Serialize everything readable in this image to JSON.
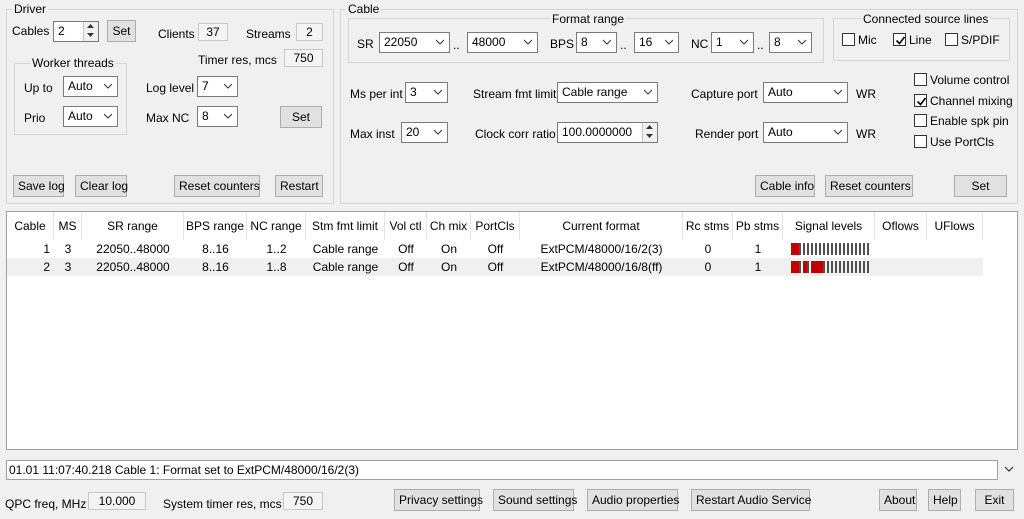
{
  "driver": {
    "title": "Driver",
    "cables_label": "Cables",
    "cables_value": "2",
    "set_label": "Set",
    "clients_label": "Clients",
    "clients_value": "37",
    "streams_label": "Streams",
    "streams_value": "2",
    "timer_label": "Timer res, mcs",
    "timer_value": "750",
    "worker_threads": {
      "title": "Worker threads",
      "upto_label": "Up to",
      "upto_value": "Auto",
      "prio_label": "Prio",
      "prio_value": "Auto"
    },
    "loglevel_label": "Log level",
    "loglevel_value": "7",
    "maxnc_label": "Max NC",
    "maxnc_value": "8",
    "set2_label": "Set",
    "save_log": "Save log",
    "clear_log": "Clear log",
    "reset_counters": "Reset counters",
    "restart": "Restart"
  },
  "cable": {
    "title": "Cable",
    "format_range": {
      "title": "Format range",
      "sr_label": "SR",
      "sr_from": "22050",
      "sr_to": "48000",
      "bps_label": "BPS",
      "bps_from": "8",
      "bps_to": "16",
      "nc_label": "NC",
      "nc_from": "1",
      "nc_to": "8",
      "range_sep": ".."
    },
    "connected": {
      "title": "Connected source lines",
      "mic": "Mic",
      "mic_checked": false,
      "line": "Line",
      "line_checked": true,
      "spdif": "S/PDIF",
      "spdif_checked": false
    },
    "ms_per_int_label": "Ms per int",
    "ms_per_int_value": "3",
    "stream_fmt_label": "Stream fmt limit",
    "stream_fmt_value": "Cable range",
    "capture_port_label": "Capture port",
    "capture_port_value": "Auto",
    "wr1": "WR",
    "max_inst_label": "Max inst",
    "max_inst_value": "20",
    "clock_corr_label": "Clock corr ratio",
    "clock_corr_value": "100.0000000",
    "render_port_label": "Render port",
    "render_port_value": "Auto",
    "wr2": "WR",
    "volume_control": "Volume control",
    "volume_control_checked": false,
    "channel_mixing": "Channel mixing",
    "channel_mixing_checked": true,
    "enable_spk_pin": "Enable spk pin",
    "enable_spk_pin_checked": false,
    "use_portcls": "Use PortCls",
    "use_portcls_checked": false,
    "cable_info": "Cable info",
    "reset_counters": "Reset counters",
    "set_label": "Set"
  },
  "table": {
    "headers": [
      "Cable",
      "MS",
      "SR range",
      "BPS range",
      "NC range",
      "Stm fmt limit",
      "Vol ctl",
      "Ch mix",
      "PortCls",
      "Current format",
      "Rc stms",
      "Pb stms",
      "Signal levels",
      "Oflows",
      "UFlows"
    ],
    "rows": [
      {
        "cable": "1",
        "ms": "3",
        "sr": "22050..48000",
        "bps": "8..16",
        "nc": "1..2",
        "stm": "Cable range",
        "vol": "Off",
        "chmix": "On",
        "portcls": "Off",
        "format": "ExtPCM/48000/16/2(3)",
        "rc": "0",
        "pb": "1",
        "levels": [
          1,
          1,
          0,
          0,
          0,
          0,
          0,
          0,
          0,
          0,
          0,
          0,
          0,
          0,
          0,
          0,
          0,
          0,
          0,
          0
        ]
      },
      {
        "cable": "2",
        "ms": "3",
        "sr": "22050..48000",
        "bps": "8..16",
        "nc": "1..8",
        "stm": "Cable range",
        "vol": "Off",
        "chmix": "On",
        "portcls": "Off",
        "format": "ExtPCM/48000/16/8(ff)",
        "rc": "0",
        "pb": "1",
        "levels": [
          1,
          1,
          0,
          1,
          0,
          1,
          1,
          1,
          0,
          0,
          0,
          0,
          0,
          0,
          0,
          0,
          0,
          0,
          0,
          0
        ]
      }
    ]
  },
  "status": {
    "log_line": "01.01  11:07:40.218  Cable 1: Format set to ExtPCM/48000/16/2(3)"
  },
  "bottom": {
    "qpc_label": "QPC freq, MHz",
    "qpc_value": "10.000",
    "systimer_label": "System timer res, mcs",
    "systimer_value": "750",
    "privacy": "Privacy settings",
    "sound": "Sound settings",
    "audio_props": "Audio properties",
    "restart_audio": "Restart Audio Service",
    "about": "About",
    "help": "Help",
    "exit": "Exit"
  },
  "colors": {
    "level_on": "#c00000",
    "level_off": "#505050"
  }
}
